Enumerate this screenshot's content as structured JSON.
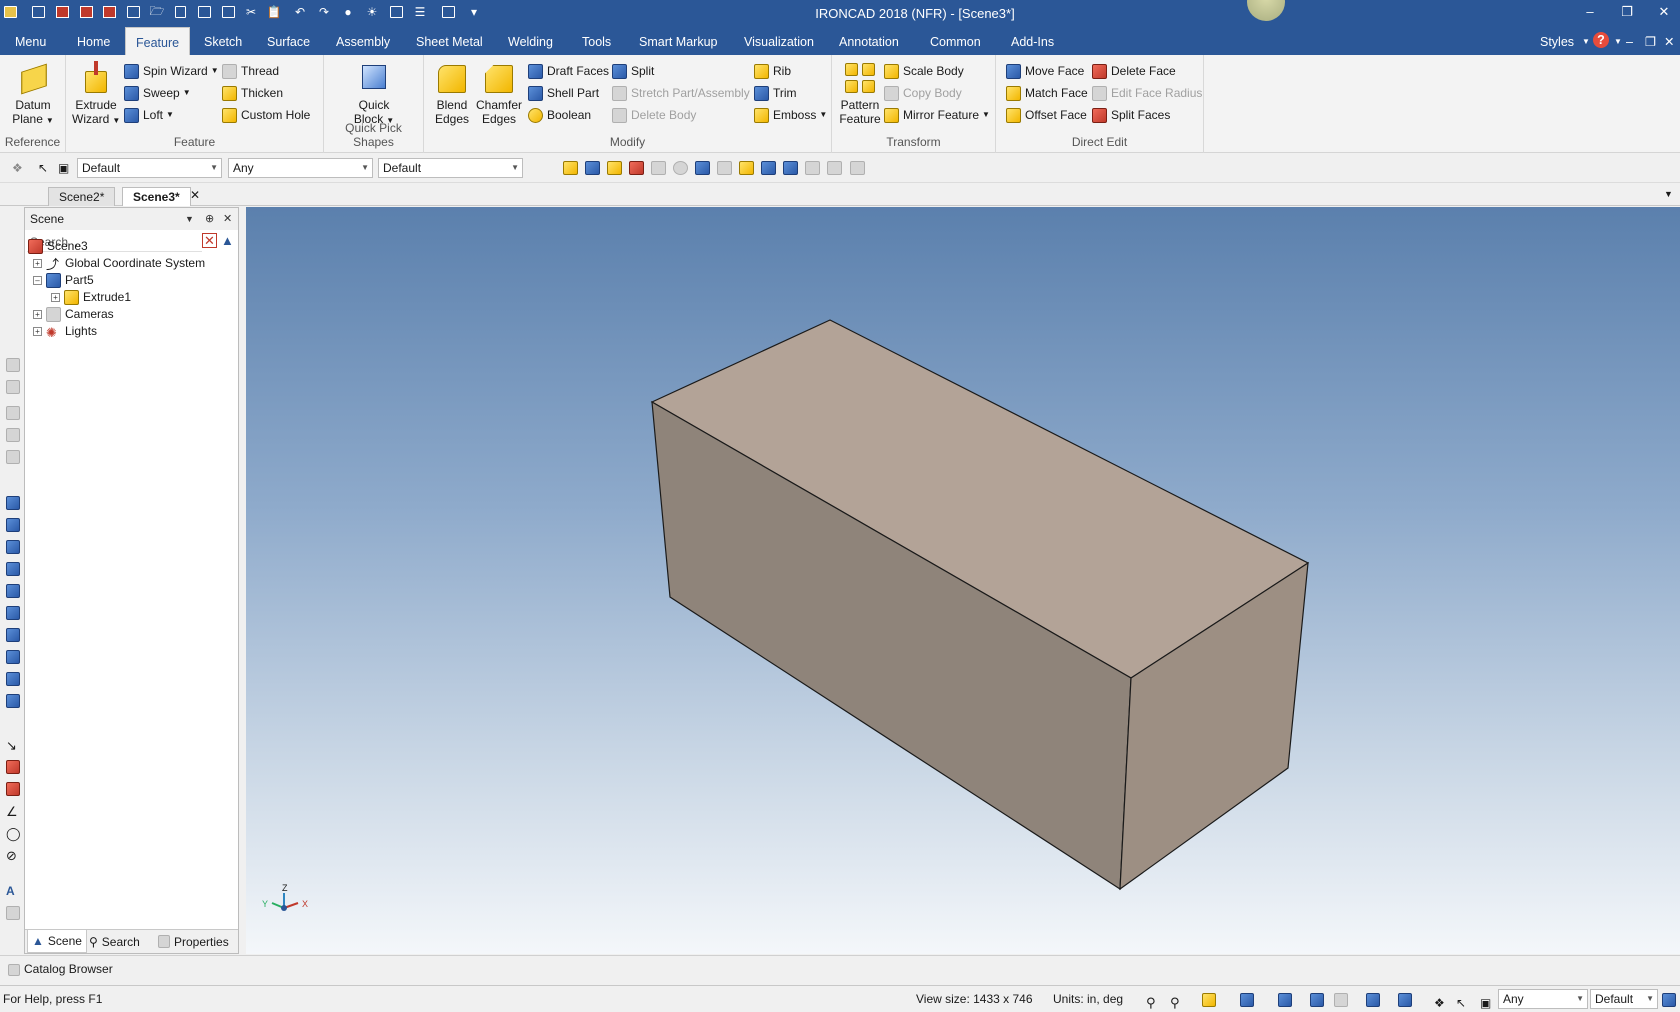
{
  "app": {
    "title": "IRONCAD 2018 (NFR) - [Scene3*]"
  },
  "ribbon_tabs": [
    "Menu",
    "Home",
    "Feature",
    "Sketch",
    "Surface",
    "Assembly",
    "Sheet Metal",
    "Welding",
    "Tools",
    "Smart Markup",
    "Visualization",
    "Annotation",
    "Common",
    "Add-Ins"
  ],
  "active_tab": "Feature",
  "styles_label": "Styles",
  "groups": {
    "reference": {
      "label": "Reference",
      "datum": [
        "Datum",
        "Plane"
      ]
    },
    "feature": {
      "label": "Feature",
      "extrude": [
        "Extrude",
        "Wizard"
      ],
      "spin": "Spin Wizard",
      "sweep": "Sweep",
      "loft": "Loft",
      "thread": "Thread",
      "thicken": "Thicken",
      "custom_hole": "Custom Hole"
    },
    "quick": {
      "label": "Quick Pick Shapes",
      "quick_block": [
        "Quick",
        "Block"
      ]
    },
    "modify": {
      "label": "Modify",
      "blend": [
        "Blend",
        "Edges"
      ],
      "chamfer": [
        "Chamfer",
        "Edges"
      ],
      "draft": "Draft Faces",
      "shell": "Shell Part",
      "boolean": "Boolean",
      "split": "Split",
      "stretch": "Stretch Part/Assembly",
      "delete_body": "Delete Body",
      "rib": "Rib",
      "trim": "Trim",
      "emboss": "Emboss"
    },
    "transform": {
      "label": "Transform",
      "pattern": [
        "Pattern",
        "Feature"
      ],
      "scale": "Scale Body",
      "copy": "Copy Body",
      "mirror": "Mirror Feature"
    },
    "direct": {
      "label": "Direct Edit",
      "move": "Move Face",
      "match": "Match Face",
      "offset": "Offset Face",
      "delete_face": "Delete Face",
      "edit_radius": "Edit Face Radius",
      "split_faces": "Split Faces"
    }
  },
  "toolbar2": {
    "combo1": "Default",
    "combo2": "Any",
    "combo3": "Default"
  },
  "doc_tabs": [
    "Scene2*",
    "Scene3*"
  ],
  "scene_panel": {
    "title": "Scene",
    "search_placeholder": "Search ...",
    "tree": [
      {
        "label": "Scene3"
      },
      {
        "label": "Global Coordinate System"
      },
      {
        "label": "Part5"
      },
      {
        "label": "Extrude1"
      },
      {
        "label": "Cameras"
      },
      {
        "label": "Lights"
      }
    ],
    "tabs": [
      "Scene",
      "Search",
      "Properties"
    ]
  },
  "axis": {
    "x": "X",
    "y": "Y",
    "z": "Z"
  },
  "catalog_browser": "Catalog Browser",
  "status": {
    "help": "For Help, press F1",
    "view_size": "View size: 1433 x  746",
    "units": "Units: in, deg",
    "combo1": "Any",
    "combo2": "Default"
  },
  "colors": {
    "titlebar": "#2b5797",
    "box_top": "#b3a397",
    "box_front": "#8f847a",
    "box_right": "#9d8f83"
  }
}
